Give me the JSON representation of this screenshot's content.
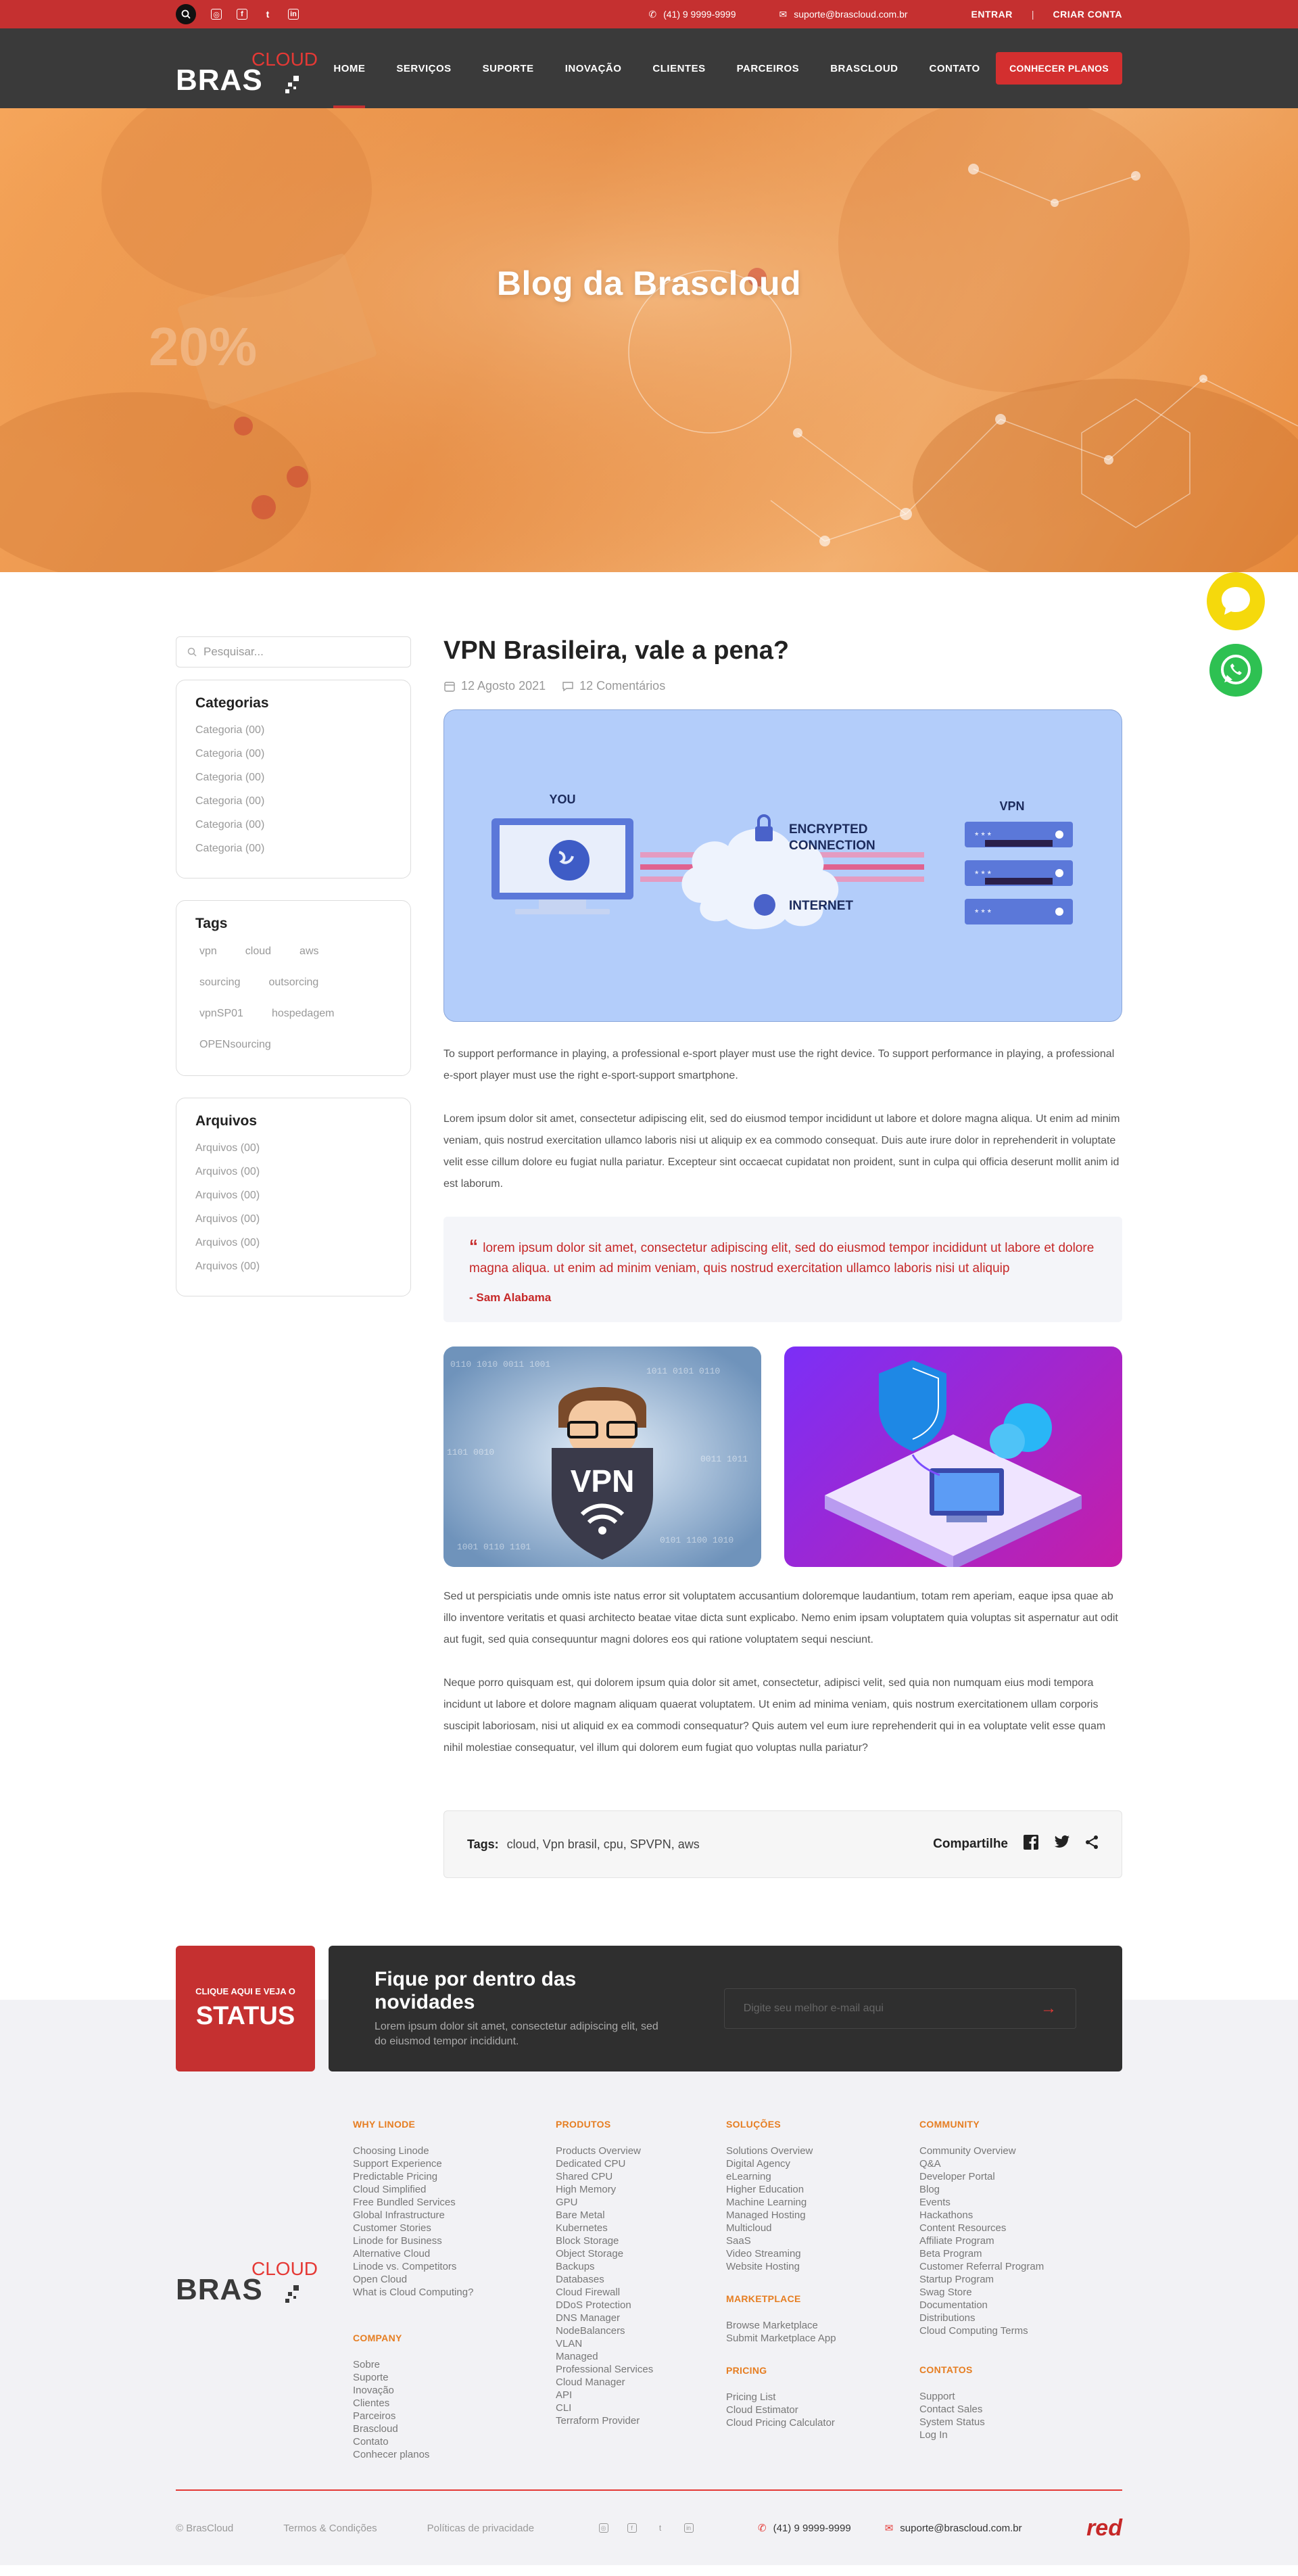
{
  "topbar": {
    "phone": "(41) 9 9999-9999",
    "email": "suporte@brascloud.com.br",
    "login": "ENTRAR",
    "separator": "|",
    "signup": "CRIAR CONTA",
    "social": [
      "instagram-icon",
      "facebook-icon",
      "twitter-icon",
      "linkedin-icon"
    ]
  },
  "brand": {
    "main": "BRAS",
    "sub": "CLOUD"
  },
  "nav": {
    "items": [
      "HOME",
      "SERVIÇOS",
      "SUPORTE",
      "INOVAÇÃO",
      "CLIENTES",
      "PARCEIROS",
      "BRASCLOUD",
      "CONTATO"
    ],
    "active": "HOME",
    "cta": "CONHECER PLANOS"
  },
  "hero": {
    "title": "Blog da Brascloud"
  },
  "sidebar": {
    "search_placeholder": "Pesquisar...",
    "categories_title": "Categorias",
    "categories": [
      "Categoria (00)",
      "Categoria (00)",
      "Categoria (00)",
      "Categoria (00)",
      "Categoria (00)",
      "Categoria (00)"
    ],
    "tags_title": "Tags",
    "tags": [
      "vpn",
      "cloud",
      "aws",
      "sourcing",
      "outsorcing",
      "vpnSP01",
      "hospedagem",
      "OPENsourcing"
    ],
    "archives_title": "Arquivos",
    "archives": [
      "Arquivos (00)",
      "Arquivos (00)",
      "Arquivos (00)",
      "Arquivos (00)",
      "Arquivos (00)",
      "Arquivos (00)"
    ]
  },
  "post": {
    "title": "VPN Brasileira, vale a pena?",
    "date": "12 Agosto 2021",
    "comments": "12 Comentários",
    "feature_labels": {
      "you": "YOU",
      "vpn": "VPN",
      "encrypted1": "ENCRYPTED",
      "encrypted2": "CONNECTION",
      "internet": "INTERNET"
    },
    "p1": "To support performance in playing, a professional e-sport player must use the right device. To support performance in playing, a professional e-sport player must use the right e-sport-support smartphone.",
    "p2": "Lorem ipsum dolor sit amet, consectetur adipiscing elit, sed do eiusmod tempor incididunt ut labore et dolore magna aliqua. Ut enim ad minim veniam, quis nostrud exercitation ullamco laboris nisi ut aliquip ex ea commodo consequat. Duis aute irure dolor in reprehenderit in voluptate velit esse cillum dolore eu fugiat nulla pariatur. Excepteur sint occaecat cupidatat non proident, sunt in culpa qui officia deserunt mollit anim id est laborum.",
    "quote": "lorem ipsum dolor sit amet, consectetur adipiscing elit, sed do eiusmod tempor incididunt ut labore et dolore magna aliqua. ut enim ad minim veniam, quis nostrud exercitation ullamco laboris nisi ut aliquip",
    "quote_author": "- Sam Alabama",
    "vpn_badge": "VPN",
    "p3": "Sed ut perspiciatis unde omnis iste natus error sit voluptatem accusantium doloremque laudantium, totam rem aperiam, eaque ipsa quae ab illo inventore veritatis et quasi architecto beatae vitae dicta sunt explicabo. Nemo enim ipsam voluptatem quia voluptas sit aspernatur aut odit aut fugit, sed quia consequuntur magni dolores eos qui ratione voluptatem sequi nesciunt.",
    "p4": "Neque porro quisquam est, qui dolorem ipsum quia dolor sit amet, consectetur, adipisci velit, sed quia non numquam eius modi tempora incidunt ut labore et dolore magnam aliquam quaerat voluptatem. Ut enim ad minima veniam, quis nostrum exercitationem ullam corporis suscipit laboriosam, nisi ut aliquid ex ea commodi consequatur? Quis autem vel eum iure reprehenderit qui in ea voluptate velit esse quam nihil molestiae consequatur, vel illum qui dolorem eum fugiat quo voluptas nulla pariatur?",
    "tags_label": "Tags:",
    "tags_value": "cloud, Vpn brasil, cpu, SPVPN, aws",
    "share_label": "Compartilhe"
  },
  "newsletter": {
    "status_small": "CLIQUE AQUI E VEJA O",
    "status_big": "STATUS",
    "title": "Fique por dentro das novidades",
    "text": "Lorem ipsum dolor sit amet, consectetur adipiscing elit, sed do eiusmod tempor incididunt.",
    "placeholder": "Digite seu melhor e-mail aqui"
  },
  "footer": {
    "why_title": "WHY LINODE",
    "why": [
      "Choosing Linode",
      "Support Experience",
      "Predictable Pricing",
      "Cloud Simplified",
      "Free Bundled Services",
      "Global Infrastructure",
      "Customer Stories",
      "Linode for Business",
      "Alternative Cloud",
      "Linode vs. Competitors",
      "Open Cloud",
      "What is Cloud Computing?"
    ],
    "company_title": "COMPANY",
    "company": [
      "Sobre",
      "Suporte",
      "Inovação",
      "Clientes",
      "Parceiros",
      "Brascloud",
      "Contato",
      "Conhecer planos"
    ],
    "products_title": "PRODUTOS",
    "products": [
      "Products Overview",
      "Dedicated CPU",
      "Shared CPU",
      "High Memory",
      "GPU",
      "Bare Metal",
      "Kubernetes",
      "Block Storage",
      "Object Storage",
      "Backups",
      "Databases",
      "Cloud Firewall",
      "DDoS Protection",
      "DNS Manager",
      "NodeBalancers",
      "VLAN",
      "Managed",
      "Professional Services",
      "Cloud Manager",
      "API",
      "CLI",
      "Terraform Provider"
    ],
    "solutions_title": "SOLUÇÕES",
    "solutions": [
      "Solutions Overview",
      "Digital Agency",
      "eLearning",
      "Higher Education",
      "Machine Learning",
      "Managed Hosting",
      "Multicloud",
      "SaaS",
      "Video Streaming",
      "Website Hosting"
    ],
    "marketplace_title": "MARKETPLACE",
    "marketplace": [
      "Browse Marketplace",
      "Submit Marketplace App"
    ],
    "pricing_title": "PRICING",
    "pricing": [
      "Pricing List",
      "Cloud Estimator",
      "Cloud Pricing Calculator"
    ],
    "community_title": "COMMUNITY",
    "community": [
      "Community Overview",
      "Q&A",
      "Developer Portal",
      "Blog",
      "Events",
      "Hackathons",
      "Content Resources",
      "Affiliate Program",
      "Beta Program",
      "Customer Referral Program",
      "Startup Program",
      "Swag Store",
      "Documentation",
      "Distributions",
      "Cloud Computing Terms"
    ],
    "contacts_title": "CONTATOS",
    "contacts": [
      "Support",
      "Contact Sales",
      "System Status",
      "Log In"
    ],
    "copyright": "© BrasCloud",
    "terms": "Termos & Condições",
    "privacy": "Políticas de privacidade",
    "phone": "(41) 9 9999-9999",
    "email": "suporte@brascloud.com.br",
    "red_logo": "red"
  },
  "colors": {
    "brand_red": "#c53030",
    "dark": "#3a3a3a",
    "hero_orange": "#ee9a4e",
    "footer_accent": "#e67e22"
  }
}
